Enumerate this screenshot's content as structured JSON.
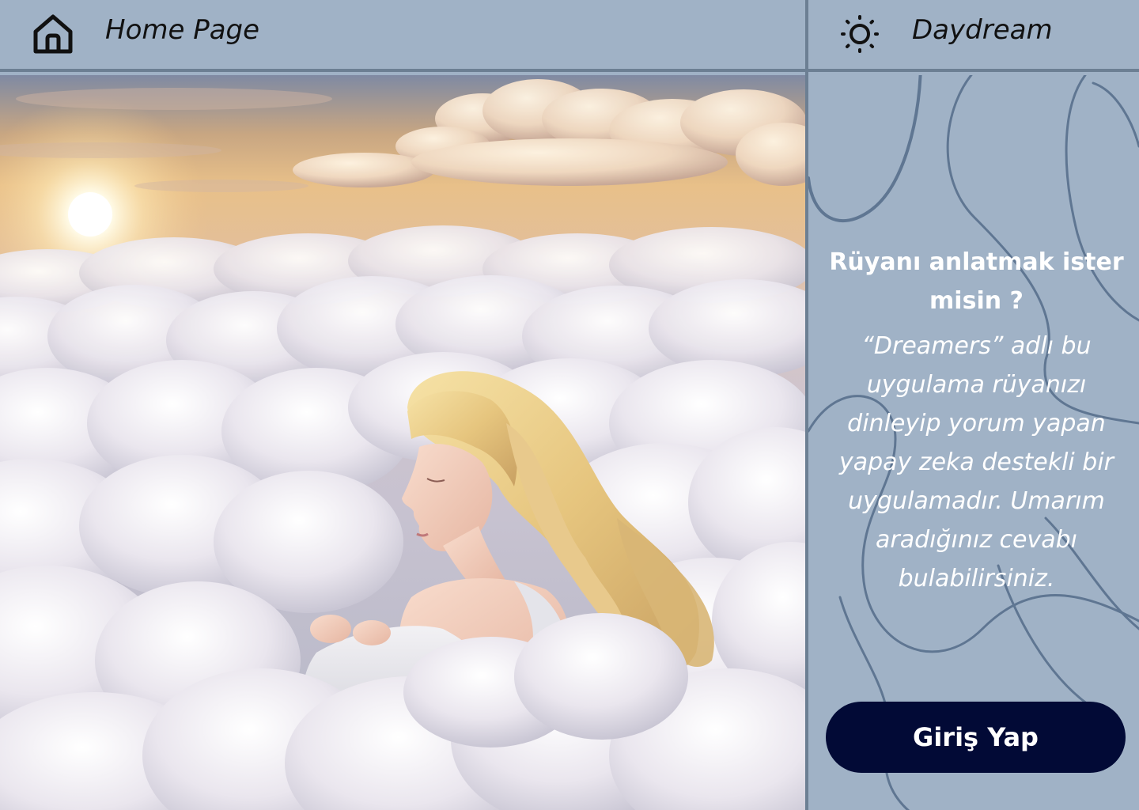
{
  "header": {
    "home_icon": "home-icon",
    "home_label": "Home Page",
    "theme_icon": "sun-icon",
    "app_name": "Daydream"
  },
  "hero": {
    "image": "woman-sleeping-on-clouds-at-sunset"
  },
  "panel": {
    "title": "Rüyanı anlatmak ister misin ?",
    "description": "“Dreamers” adlı bu uygulama rüyanızı dinleyip yorum yapan yapay zeka destekli bir uygulamadır. Umarım aradığınız cevabı bulabilirsiniz.",
    "login_label": "Giriş Yap"
  },
  "colors": {
    "background": "#a0b2c6",
    "divider": "#6c7f93",
    "button": "#020a36",
    "panel_text": "#ffffff"
  }
}
